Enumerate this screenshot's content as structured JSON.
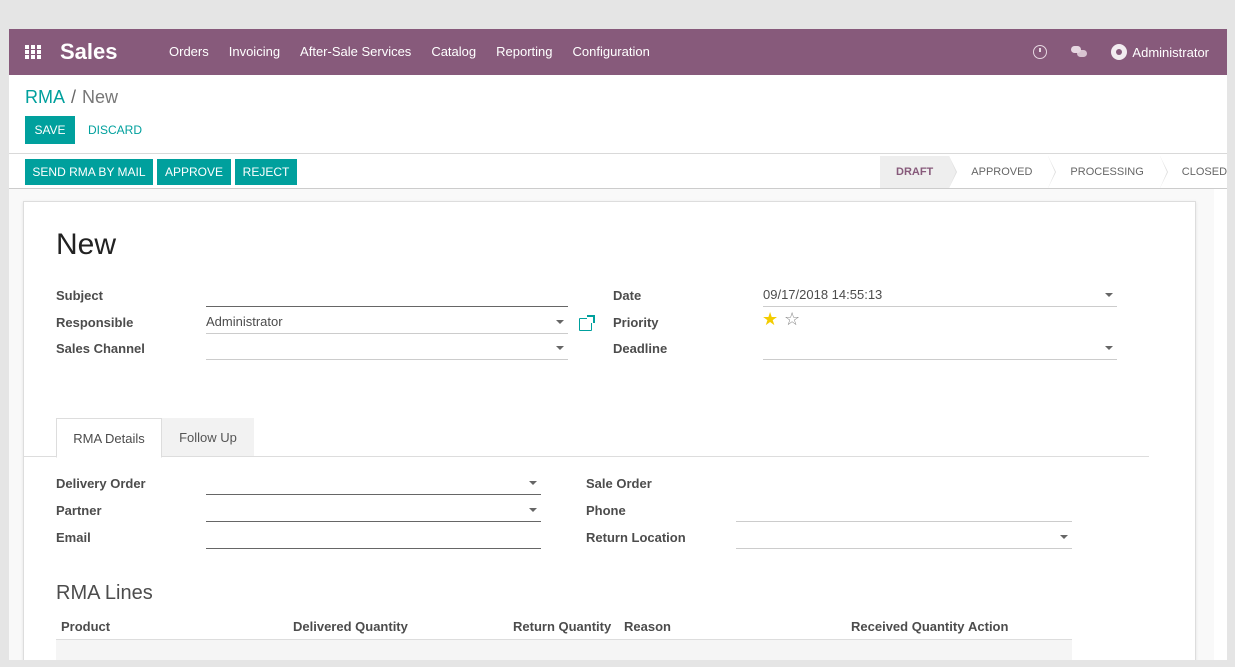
{
  "navbar": {
    "app_name": "Sales",
    "menu": [
      "Orders",
      "Invoicing",
      "After-Sale Services",
      "Catalog",
      "Reporting",
      "Configuration"
    ],
    "user": "Administrator",
    "color": "#875a7b"
  },
  "breadcrumb": {
    "parent": "RMA",
    "separator": "/",
    "current": "New"
  },
  "buttons": {
    "save": "SAVE",
    "discard": "DISCARD"
  },
  "statusbar": {
    "actions": [
      "SEND RMA BY MAIL",
      "APPROVE",
      "REJECT"
    ],
    "stages": [
      "DRAFT",
      "APPROVED",
      "PROCESSING",
      "CLOSED"
    ],
    "active_stage": "DRAFT"
  },
  "form": {
    "title": "New",
    "labels": {
      "subject": "Subject",
      "responsible": "Responsible",
      "sales_channel": "Sales Channel",
      "date": "Date",
      "priority": "Priority",
      "deadline": "Deadline"
    },
    "values": {
      "subject": "",
      "responsible": "Administrator",
      "sales_channel": "",
      "date": "09/17/2018 14:55:13",
      "priority_stars": 1,
      "priority_max": 2,
      "deadline": ""
    }
  },
  "tabs": {
    "rma_details": "RMA Details",
    "follow_up": "Follow Up"
  },
  "details": {
    "labels": {
      "delivery_order": "Delivery Order",
      "partner": "Partner",
      "email": "Email",
      "sale_order": "Sale Order",
      "phone": "Phone",
      "return_location": "Return Location"
    }
  },
  "lines": {
    "title": "RMA Lines",
    "columns": [
      "Product",
      "Delivered Quantity",
      "Return Quantity",
      "Reason",
      "Received Quantity",
      "Action"
    ]
  },
  "colors": {
    "accent": "#00a09d",
    "brand": "#875a7b",
    "star_on": "#f3cc00"
  }
}
